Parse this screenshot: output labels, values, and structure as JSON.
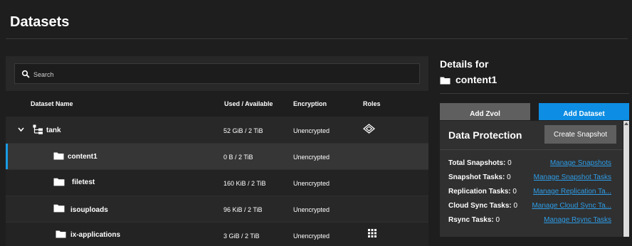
{
  "page": {
    "title": "Datasets"
  },
  "search": {
    "placeholder": "Search"
  },
  "table": {
    "headers": {
      "name": "Dataset Name",
      "used": "Used / Available",
      "encryption": "Encryption",
      "roles": "Roles"
    },
    "rows": [
      {
        "name": "tank",
        "used": "52 GiB / 2 TiB",
        "encryption": "Unencrypted",
        "role_icon": "share-icon"
      },
      {
        "name": "content1",
        "used": "0 B / 2 TiB",
        "encryption": "Unencrypted",
        "role_icon": ""
      },
      {
        "name": "filetest",
        "used": "160 KiB / 2 TiB",
        "encryption": "Unencrypted",
        "role_icon": ""
      },
      {
        "name": "isouploads",
        "used": "96 KiB / 2 TiB",
        "encryption": "Unencrypted",
        "role_icon": ""
      },
      {
        "name": "ix-applications",
        "used": "3 GiB / 2 TiB",
        "encryption": "Unencrypted",
        "role_icon": "apps-grid-icon"
      }
    ]
  },
  "details": {
    "heading": "Details for",
    "dataset_name": "content1",
    "buttons": {
      "add_zvol": "Add Zvol",
      "add_dataset": "Add Dataset"
    }
  },
  "data_protection": {
    "title": "Data Protection",
    "create_snapshot": "Create Snapshot",
    "stats": [
      {
        "label": "Total Snapshots:",
        "value": "0",
        "link": "Manage Snapshots"
      },
      {
        "label": "Snapshot Tasks:",
        "value": "0",
        "link": "Manage Snapshot Tasks"
      },
      {
        "label": "Replication Tasks:",
        "value": "0",
        "link": "Manage Replication Ta..."
      },
      {
        "label": "Cloud Sync Tasks:",
        "value": "0",
        "link": "Manage Cloud Sync Ta..."
      },
      {
        "label": "Rsync Tasks:",
        "value": "0",
        "link": "Manage Rsync Tasks"
      }
    ]
  },
  "colors": {
    "accent": "#0d8de3",
    "link": "#2e9ce6",
    "background": "#1e1e1e",
    "selection": "#1a9be6"
  }
}
